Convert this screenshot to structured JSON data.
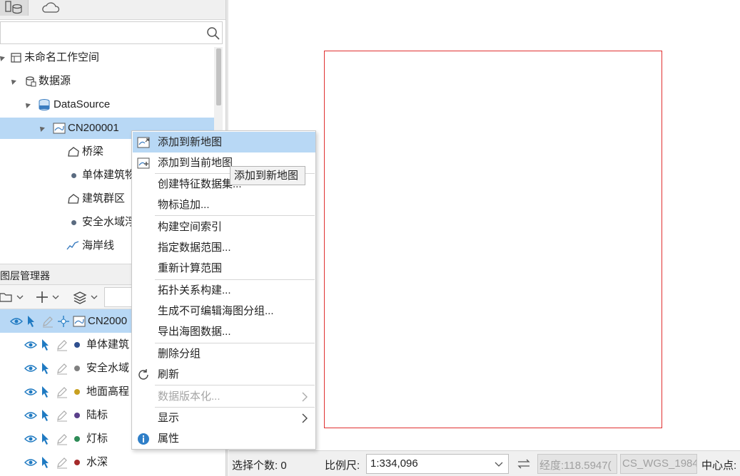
{
  "workspace_tree": {
    "search_placeholder": "",
    "items": [
      {
        "label": "未命名工作空间"
      },
      {
        "label": "数据源"
      },
      {
        "label": "DataSource"
      },
      {
        "label": "CN200001"
      },
      {
        "label": "桥梁"
      },
      {
        "label": "单体建筑物"
      },
      {
        "label": "建筑群区"
      },
      {
        "label": "安全水域浮"
      },
      {
        "label": "海岸线"
      }
    ]
  },
  "layer_manager": {
    "title": "图层管理器",
    "root_label": "CN2000",
    "layers": [
      {
        "label": "单体建筑",
        "color": "#2f4f8f"
      },
      {
        "label": "安全水域",
        "color": "#808080"
      },
      {
        "label": "地面高程",
        "color": "#c8a020"
      },
      {
        "label": "陆标",
        "color": "#5a3f8a"
      },
      {
        "label": "灯标",
        "color": "#2e8b57"
      },
      {
        "label": "水深",
        "color": "#a52a2a"
      }
    ]
  },
  "context_menu": {
    "items": [
      {
        "label": "添加到新地图",
        "icon": "add-new-map-icon"
      },
      {
        "label": "添加到当前地图",
        "icon": "add-current-map-icon"
      },
      {
        "label": "创建特征数据集..."
      },
      {
        "label": "物标追加..."
      },
      {
        "label": "构建空间索引"
      },
      {
        "label": "指定数据范围..."
      },
      {
        "label": "重新计算范围"
      },
      {
        "label": "拓扑关系构建..."
      },
      {
        "label": "生成不可编辑海图分组..."
      },
      {
        "label": "导出海图数据..."
      },
      {
        "label": "删除分组"
      },
      {
        "label": "刷新",
        "icon": "refresh-icon"
      },
      {
        "label": "数据版本化...",
        "disabled": true
      },
      {
        "label": "显示"
      },
      {
        "label": "属性",
        "icon": "info-icon"
      }
    ],
    "tooltip": "添加到新地图"
  },
  "status_bar": {
    "selected_count_label": "选择个数: 0",
    "scale_label": "比例尺:",
    "scale_value": "1:334,096",
    "longitude": "经度:118.5947(",
    "crs": "CS_WGS_1984",
    "center_label": "中心点:"
  },
  "colors": {
    "selection": "#b8d8f5",
    "map_frame": "#e03030"
  }
}
